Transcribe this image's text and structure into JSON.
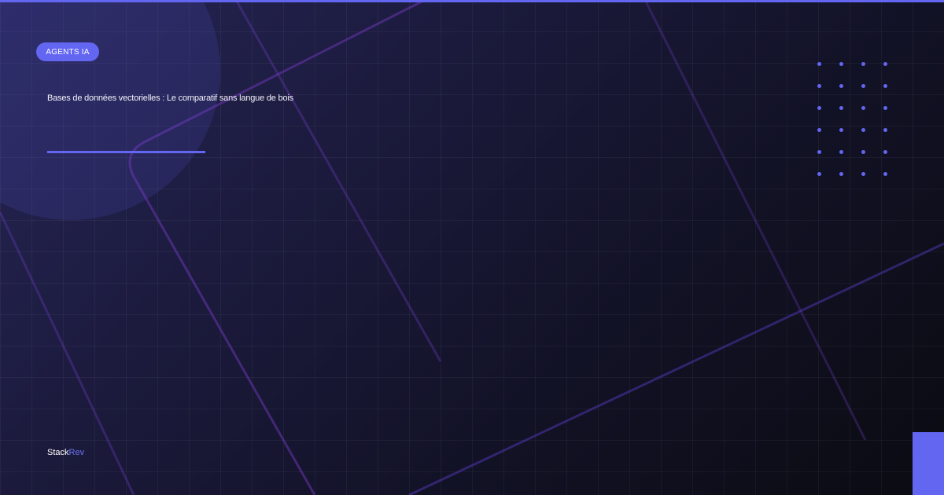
{
  "badge": {
    "label": "AGENTS IA"
  },
  "headline": {
    "text": "Bases de données vectorielles : Le comparatif sans langue de bois"
  },
  "brand": {
    "name_main": "Stack",
    "name_accent": "Rev"
  },
  "colors": {
    "accent": "#6366f1",
    "background_dark": "#0e0d18",
    "text": "#ffffff"
  },
  "decorations": {
    "dot_grid": {
      "rows": 6,
      "cols": 4
    }
  }
}
